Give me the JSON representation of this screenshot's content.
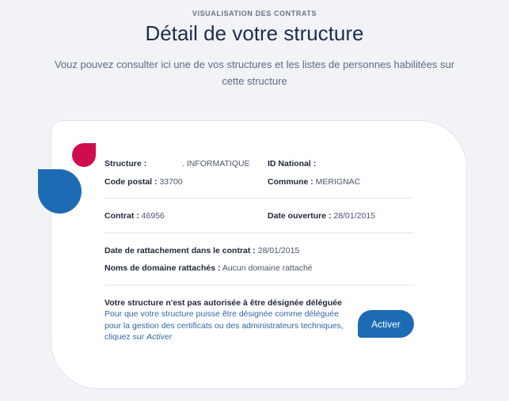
{
  "header": {
    "eyebrow": "VISUALISATION DES CONTRATS",
    "title": "Détail de votre structure",
    "subtitle": "Vouz pouvez consulter ici une de vos structures et les listes de personnes habilitées sur cette structure"
  },
  "structure": {
    "structure_label": "Structure :",
    "structure_value": ". INFORMATIQUE",
    "id_national_label": "ID National :",
    "id_national_value": "",
    "code_postal_label": "Code postal :",
    "code_postal_value": "33700",
    "commune_label": "Commune :",
    "commune_value": "MERIGNAC"
  },
  "contract": {
    "contrat_label": "Contrat :",
    "contrat_value": "46956",
    "date_ouverture_label": "Date ouverture :",
    "date_ouverture_value": "28/01/2015",
    "date_rattachement_label": "Date de rattachement dans le contrat :",
    "date_rattachement_value": "28/01/2015",
    "domaines_label": "Noms de domaine rattachés :",
    "domaines_value": "Aucun domaine rattaché"
  },
  "delegation": {
    "title": "Votre structure n'est pas autorisée à être désignée déléguée",
    "text": "Pour que votre structure puisse être désignée comme déléguée pour la gestion des certificats ou des administrateurs techniques, cliquez sur",
    "text_link_word": "Activer",
    "button_label": "Activer"
  },
  "colors": {
    "brand_blue": "#1d6bb4",
    "brand_red": "#cf0d4d",
    "title_navy": "#1e2d4a"
  }
}
